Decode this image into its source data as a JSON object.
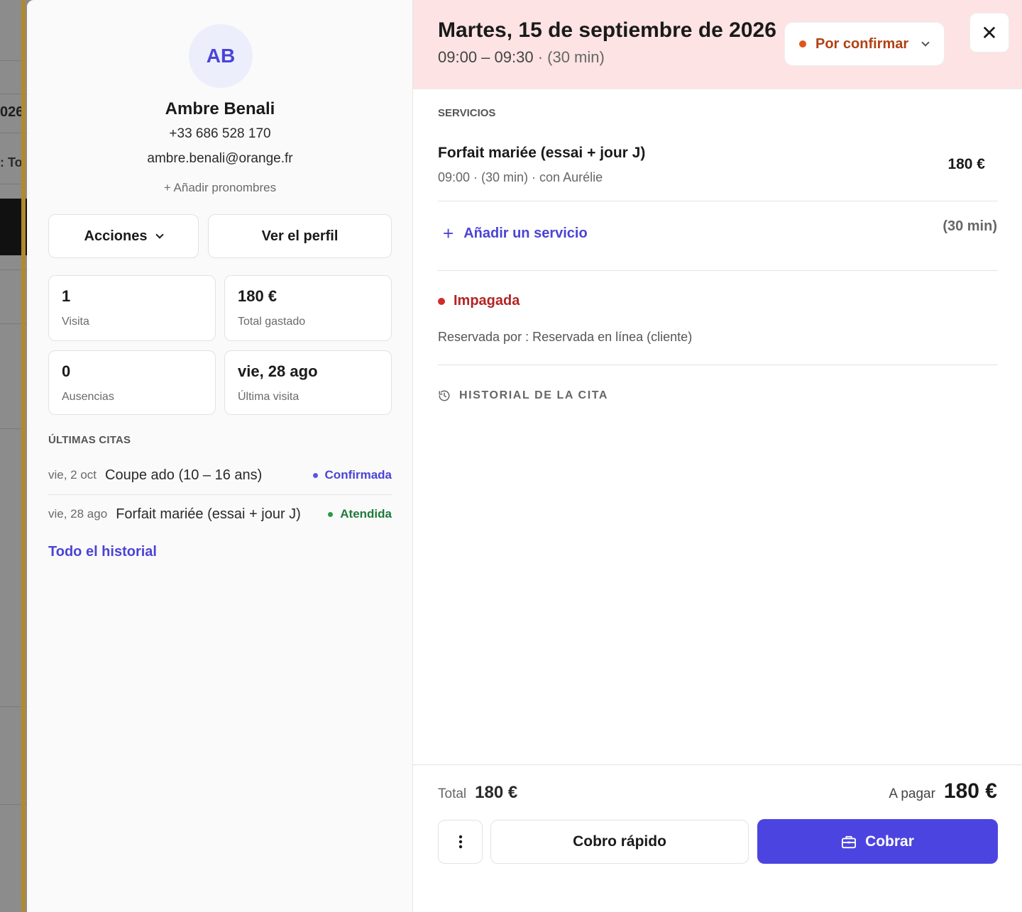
{
  "background": {
    "text1": "026",
    "text2": ": To"
  },
  "client": {
    "initials": "AB",
    "name": "Ambre Benali",
    "phone": "+33 686 528 170",
    "email": "ambre.benali@orange.fr",
    "add_pronouns": "+ Añadir pronombres",
    "actions_label": "Acciones",
    "view_profile_label": "Ver el perfil",
    "stats": {
      "visits": {
        "value": "1",
        "label": "Visita"
      },
      "spent": {
        "value": "180 €",
        "label": "Total gastado"
      },
      "absences": {
        "value": "0",
        "label": "Ausencias"
      },
      "last_visit": {
        "value": "vie, 28 ago",
        "label": "Última visita"
      }
    },
    "recent_title": "ÚLTIMAS CITAS",
    "recent": [
      {
        "date": "vie, 2 oct",
        "service": "Coupe ado (10 – 16 ans)",
        "status": "Confirmada",
        "color": "#4a44d6"
      },
      {
        "date": "vie, 28 ago",
        "service": "Forfait mariée (essai + jour J)",
        "status": "Atendida",
        "color": "#1f7a3a"
      }
    ],
    "history_link": "Todo el historial"
  },
  "appointment": {
    "date": "Martes, 15 de septiembre de 2026",
    "time": "09:00 – 09:30",
    "duration": "· (30 min)",
    "status": "Por confirmar",
    "services_title": "SERVICIOS",
    "service": {
      "name": "Forfait mariée (essai + jour J)",
      "meta": "09:00 · (30 min) · con Aurélie",
      "price": "180 €"
    },
    "add_service": "Añadir un servicio",
    "total_duration": "(30 min)",
    "payment_status": "Impagada",
    "booked_by": "Reservada por : Reservada en línea (cliente)",
    "history_title": "HISTORIAL DE LA CITA"
  },
  "footer": {
    "total_label": "Total",
    "total_value": "180 €",
    "to_pay_label": "A pagar",
    "to_pay_value": "180 €",
    "quick_charge": "Cobro rápido",
    "charge": "Cobrar"
  },
  "colors": {
    "accent": "#4c44e0",
    "header_bg": "#fde3e3",
    "pending": "#e0551a",
    "unpaid": "#d12b2b"
  }
}
